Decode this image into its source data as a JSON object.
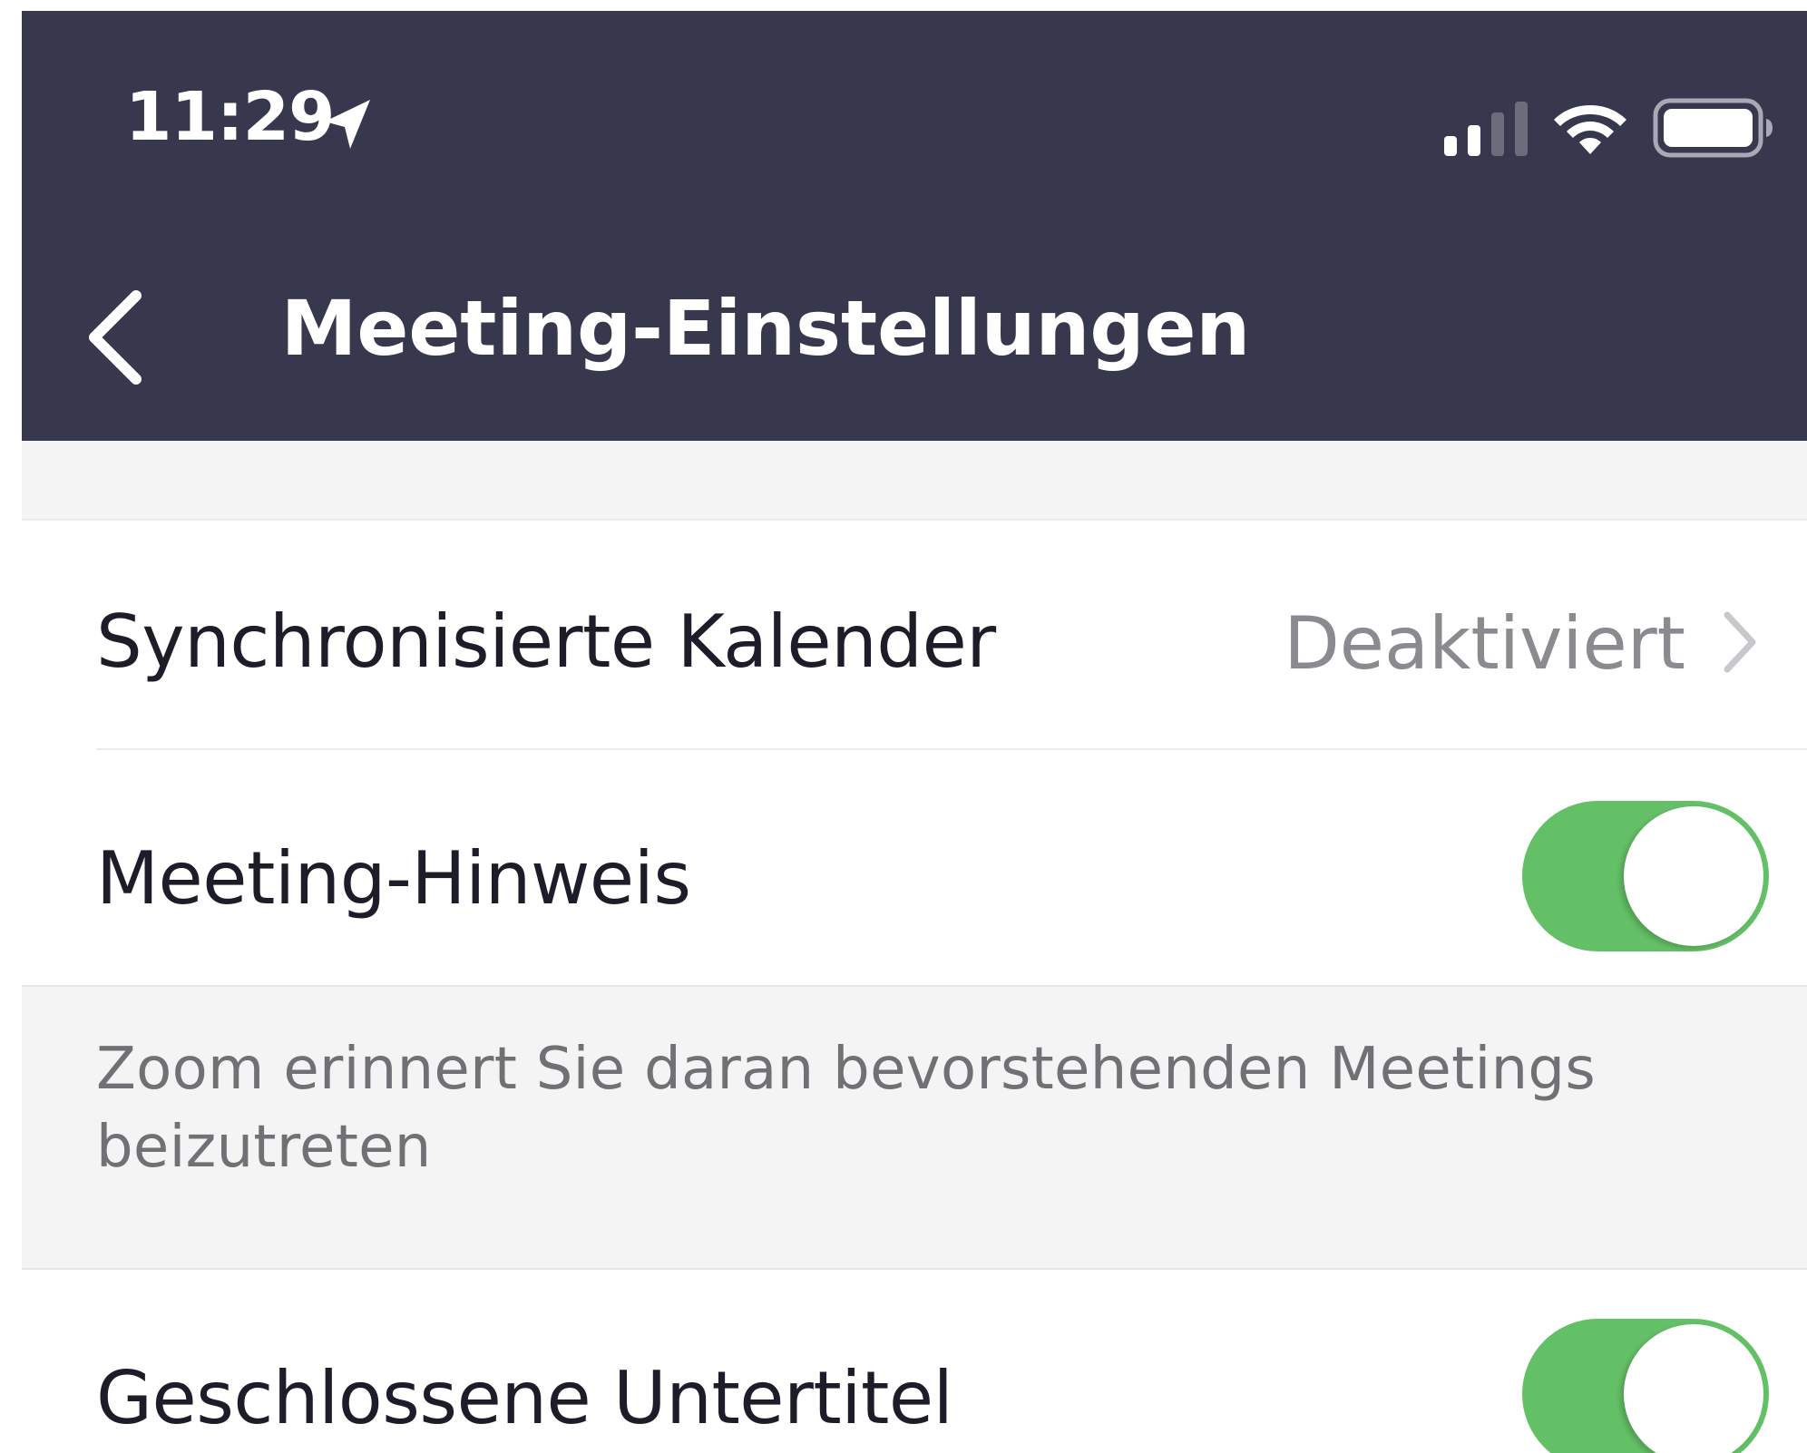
{
  "status_bar": {
    "time": "11:29",
    "location_icon": "location-arrow-icon",
    "signal_icon": "cellular-signal-icon",
    "wifi_icon": "wifi-icon",
    "battery_icon": "battery-icon"
  },
  "nav": {
    "title": "Meeting-Einstellungen",
    "back_icon": "chevron-left-icon"
  },
  "settings": {
    "synced_calendars": {
      "label": "Synchronisierte Kalender",
      "value": "Deaktiviert"
    },
    "meeting_reminder": {
      "label": "Meeting-Hinweis",
      "enabled": true,
      "hint": "Zoom erinnert Sie daran bevorstehenden Meetings beizutreten"
    },
    "closed_captions": {
      "label": "Geschlossene Untertitel",
      "enabled": true
    }
  },
  "colors": {
    "header_bg": "#37374d",
    "toggle_on": "#64c066",
    "section_bg": "#f4f4f4",
    "label_text": "#1d1d29",
    "secondary_text": "#8a8a8f"
  }
}
